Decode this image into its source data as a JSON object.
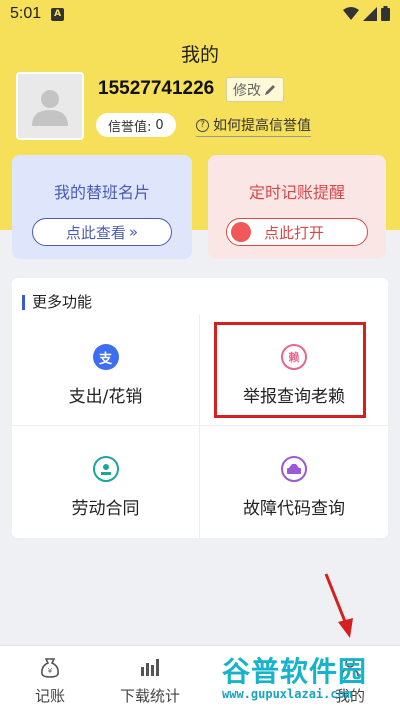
{
  "status_bar": {
    "time": "5:01",
    "notif_badge": "A"
  },
  "header": {
    "title": "我的",
    "phone": "15527741226",
    "edit_label": "修改",
    "credit_label": "信誉值:",
    "credit_value": "0",
    "credit_help": "如何提高信誉值"
  },
  "cards": {
    "substitute": {
      "title": "我的替班名片",
      "button": "点此查看"
    },
    "reminder": {
      "title": "定时记账提醒",
      "button": "点此打开"
    }
  },
  "more": {
    "title": "更多功能",
    "items": [
      {
        "label": "支出/花销",
        "icon_text": "支",
        "icon": "expense-icon",
        "color": "#3d6ef0"
      },
      {
        "label": "举报查询老赖",
        "icon_text": "赖",
        "icon": "report-icon",
        "color": "#e8668a"
      },
      {
        "label": "劳动合同",
        "icon_text": "",
        "icon": "contract-icon",
        "color": "#1aa69a"
      },
      {
        "label": "故障代码查询",
        "icon_text": "",
        "icon": "fault-code-icon",
        "color": "#9b59d6"
      }
    ]
  },
  "bottom_nav": [
    {
      "label": "记账",
      "icon": "money-bag-icon"
    },
    {
      "label": "下载统计",
      "icon": "chart-icon"
    },
    {
      "label": "",
      "icon": "tab-icon"
    },
    {
      "label": "我的",
      "icon": "profile-icon"
    }
  ],
  "watermark": {
    "main": "谷普软件园",
    "url": "www.gupuxlazai.com"
  },
  "colors": {
    "header_bg": "#f6e05a",
    "accent_blue": "#4a5bb5",
    "accent_red": "#d94848",
    "highlight": "#d32020"
  }
}
